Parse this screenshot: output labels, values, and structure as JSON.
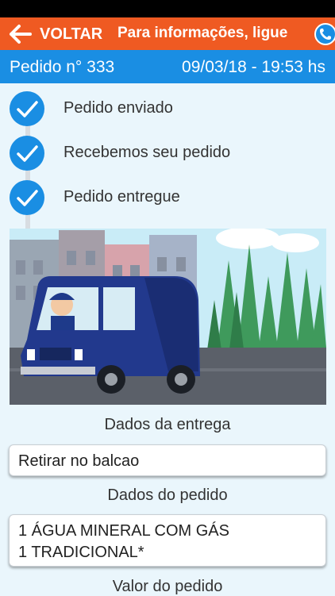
{
  "header": {
    "back_label": "VOLTAR",
    "info_text": "Para informações, ligue",
    "accent_color": "#ef5a22",
    "icons": [
      "arrow-left-icon",
      "phone-icon"
    ]
  },
  "order": {
    "number_label": "Pedido n° 333",
    "datetime": "09/03/18 - 19:53 hs",
    "bar_color": "#1a8ee3"
  },
  "steps": [
    {
      "label": "Pedido enviado"
    },
    {
      "label": "Recebemos seu pedido"
    },
    {
      "label": "Pedido entregue"
    }
  ],
  "delivery": {
    "title": "Dados da entrega",
    "value": "Retirar no balcao"
  },
  "items_section": {
    "title": "Dados do pedido",
    "lines": [
      "1 ÁGUA MINERAL COM GÁS",
      "1 TRADICIONAL*"
    ]
  },
  "total_section": {
    "title": "Valor do pedido"
  }
}
